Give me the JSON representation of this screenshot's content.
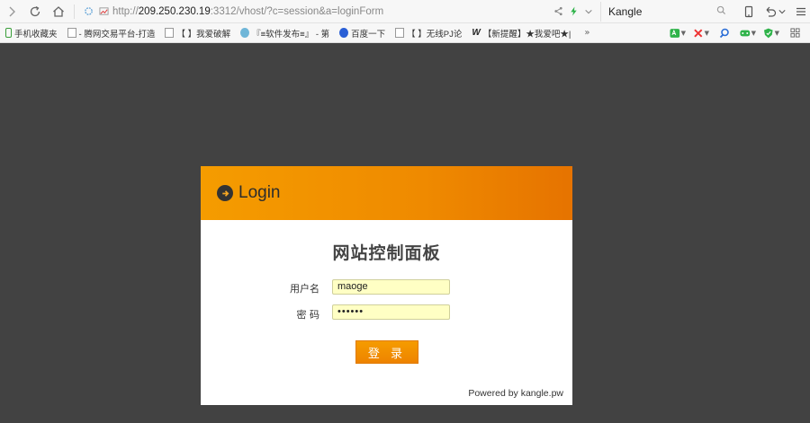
{
  "browser": {
    "url_prefix": "http://",
    "url_host": "209.250.230.19",
    "url_rest": ":3312/vhost/?c=session&a=loginForm",
    "search_text": "Kangle"
  },
  "bookmarks": [
    {
      "label": "手机收藏夹",
      "icon": "phone-icon"
    },
    {
      "label": "- 腾网交易平台-打造",
      "icon": "doc-icon"
    },
    {
      "label": "【          】我爱破解",
      "icon": "doc-icon"
    },
    {
      "label": "『≡软件发布≡』 - 第",
      "icon": "circle-icon"
    },
    {
      "label": "百度一下",
      "icon": "baidu-paw-icon"
    },
    {
      "label": "【          】无线PJ论",
      "icon": "doc-icon"
    },
    {
      "label": "【新提醒】★我爱吧★|",
      "icon": "w-icon"
    }
  ],
  "bookmarks_more": "»",
  "panel": {
    "header_title": "Login",
    "title": "网站控制面板",
    "username_label": "用户名",
    "username_value": "maoge",
    "password_label": "密  码",
    "password_value": "••••••",
    "login_button": "登 录",
    "powered_by": "Powered by kangle.pw"
  },
  "colors": {
    "accent": "#f39200",
    "page_bg": "#424242",
    "input_bg": "#ffffc4"
  }
}
